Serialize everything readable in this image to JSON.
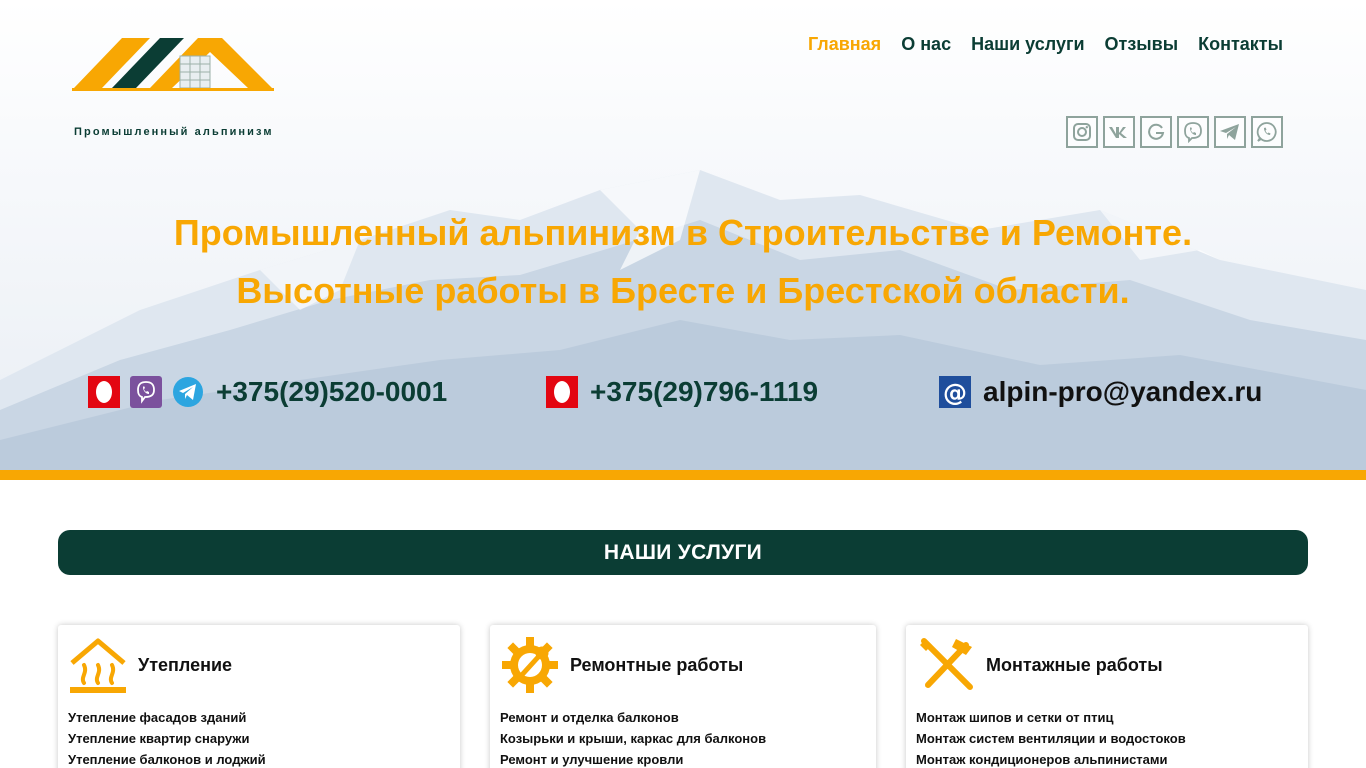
{
  "brand": {
    "tagline": "Промышленный альпинизм"
  },
  "nav": {
    "items": [
      {
        "label": "Главная",
        "active": true
      },
      {
        "label": "О нас",
        "active": false
      },
      {
        "label": "Наши услуги",
        "active": false
      },
      {
        "label": "Отзывы",
        "active": false
      },
      {
        "label": "Контакты",
        "active": false
      }
    ]
  },
  "social": [
    "instagram-icon",
    "vk-icon",
    "google-icon",
    "viber-icon",
    "telegram-icon",
    "whatsapp-icon"
  ],
  "hero": {
    "headline_1": "Промышленный альпинизм в Строительстве и Ремонте.",
    "headline_2": "Высотные работы в Бресте и Брестской области."
  },
  "contacts": {
    "phone_1": "+375(29)520-0001",
    "phone_2": "+375(29)796-1119",
    "email": "alpin-pro@yandex.ru"
  },
  "services": {
    "heading": "НАШИ УСЛУГИ",
    "cards": [
      {
        "title": "Утепление",
        "icon": "insulation-icon",
        "items": [
          "Утепление фасадов зданий",
          "Утепление квартир снаружи",
          "Утепление балконов и лоджий"
        ]
      },
      {
        "title": "Ремонтные работы",
        "icon": "repair-gear-icon",
        "items": [
          "Ремонт и отделка балконов",
          "Козырьки и крыши, каркас для балконов",
          "Ремонт и улучшение кровли"
        ]
      },
      {
        "title": "Монтажные работы",
        "icon": "tools-icon",
        "items": [
          "Монтаж шипов и сетки от птиц",
          "Монтаж систем вентиляции и водостоков",
          "Монтаж кондиционеров альпинистами"
        ]
      }
    ]
  },
  "colors": {
    "accent": "#f8a703",
    "dark_green": "#0b3d34"
  }
}
